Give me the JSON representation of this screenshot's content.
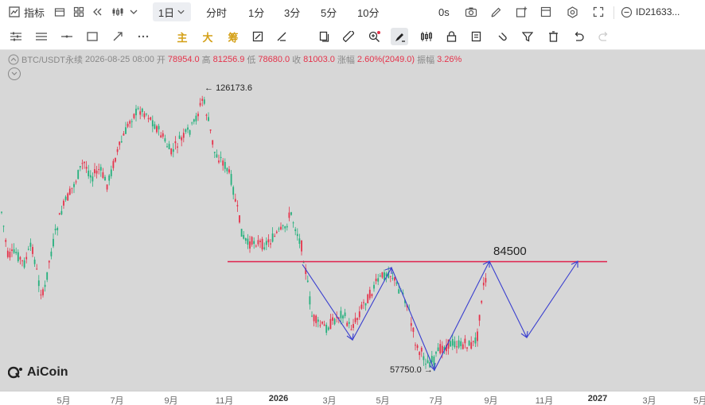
{
  "toolbar1": {
    "indicator_label": "指标",
    "interval_selected": "1日",
    "intervals": [
      "分时",
      "1分",
      "3分",
      "5分",
      "10分"
    ],
    "zero_s": "0s",
    "account_id": "ID21633..."
  },
  "toolbar2": {
    "main_label": "主",
    "sub_label": "大",
    "chip_label": "筹"
  },
  "info": {
    "symbol": "BTC/USDT永续",
    "datetime": "2026-08-25 08:00",
    "open_label": "开",
    "open": "78954.0",
    "high_label": "高",
    "high": "81256.9",
    "low_label": "低",
    "low": "78680.0",
    "close_label": "收",
    "close": "81003.0",
    "change_label": "涨幅",
    "change": "2.60%(2049.0)",
    "amp_label": "振幅",
    "amp": "3.26%"
  },
  "annotations": {
    "high_marker": "126173.6",
    "low_marker": "57750.0",
    "level_label": "84500"
  },
  "xaxis": {
    "labels": [
      "5月",
      "7月",
      "9月",
      "11月",
      "2026",
      "3月",
      "5月",
      "7月",
      "9月",
      "11月",
      "2027",
      "3月",
      "5月"
    ]
  },
  "logo_text": "AiCoin",
  "colors": {
    "up": "#e5334b",
    "down": "#26b07d",
    "level_line": "#e0204c",
    "projection": "#3a3fcf",
    "background": "#d7d7d7"
  },
  "chart_data": {
    "type": "candlestick",
    "level": 84500,
    "high_point": 126173.6,
    "low_point": 57750.0
  }
}
